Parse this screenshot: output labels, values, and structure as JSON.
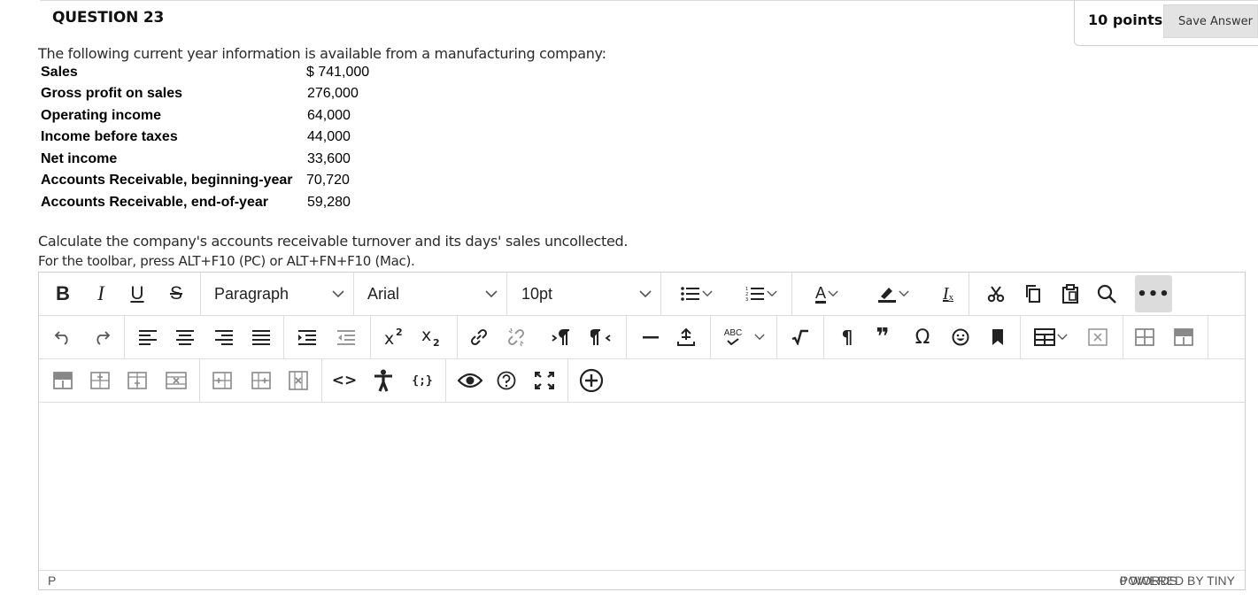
{
  "question": {
    "title": "QUESTION 23",
    "points": "10 points",
    "save_label": "Save Answer"
  },
  "intro": "The following current year information is available from a manufacturing company:",
  "financials": [
    {
      "label": "Sales",
      "value": "$ 741,000"
    },
    {
      "label": "Gross profit on sales",
      "value": "276,000"
    },
    {
      "label": "Operating income",
      "value": "64,000"
    },
    {
      "label": "Income before taxes",
      "value": "44,000"
    },
    {
      "label": "Net income",
      "value": "33,600"
    },
    {
      "label": "Accounts Receivable, beginning-year",
      "value": "70,720"
    },
    {
      "label": "Accounts Receivable, end-of-year",
      "value": "59,280"
    }
  ],
  "prompt": "Calculate the company's accounts receivable turnover and its days' sales uncollected.",
  "toolbar_hint": "For the toolbar, press ALT+F10 (PC) or ALT+FN+F10 (Mac).",
  "editor": {
    "block_format": "Paragraph",
    "font_family": "Arial",
    "font_size": "10pt",
    "more_label": "•••",
    "status_path": "P",
    "word_count": "0 WORDS",
    "powered_by": "POWERED BY TINY"
  },
  "icons": {
    "bold": "B",
    "italic": "I",
    "underline": "U",
    "strikethrough": "S",
    "font_color": "A",
    "pilcrow": "¶",
    "quote": "❞",
    "omega": "Ω",
    "spellcheck": "ABC",
    "clear_format": "I",
    "code": "<>",
    "variable": "{;}"
  }
}
